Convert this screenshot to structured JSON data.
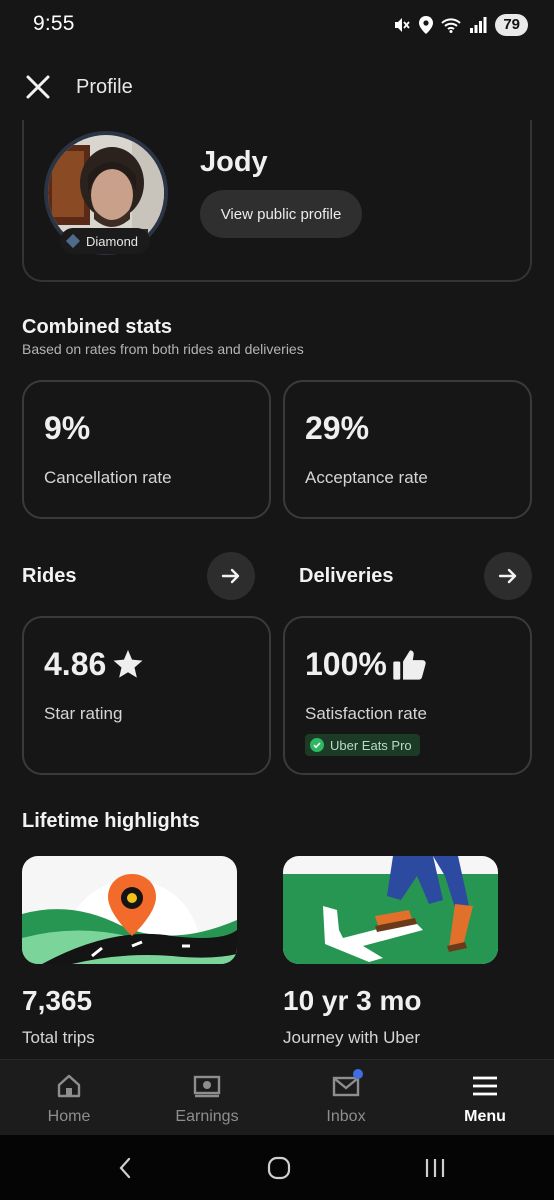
{
  "status_bar": {
    "time": "9:55",
    "battery": "79",
    "icons": [
      "mute-icon",
      "location-icon",
      "wifi-icon",
      "signal-icon"
    ]
  },
  "header": {
    "title": "Profile",
    "close_icon": "close-icon"
  },
  "profile": {
    "name": "Jody",
    "tier": "Diamond",
    "public_profile_label": "View public profile"
  },
  "combined_stats": {
    "title": "Combined stats",
    "subtitle": "Based on rates from both rides and deliveries",
    "cards": [
      {
        "value": "9%",
        "label": "Cancellation rate"
      },
      {
        "value": "29%",
        "label": "Acceptance rate"
      }
    ]
  },
  "rides": {
    "title": "Rides",
    "value": "4.86",
    "label": "Star rating",
    "icon": "star-icon"
  },
  "deliveries": {
    "title": "Deliveries",
    "value": "100%",
    "label": "Satisfaction rate",
    "icon": "thumbs-up-icon",
    "badge": "Uber Eats Pro"
  },
  "highlights": {
    "title": "Lifetime highlights",
    "items": [
      {
        "value": "7,365",
        "label": "Total trips"
      },
      {
        "value": "10 yr 3 mo",
        "label": "Journey with Uber"
      }
    ]
  },
  "bottom_nav": {
    "items": [
      {
        "label": "Home",
        "icon": "home-icon"
      },
      {
        "label": "Earnings",
        "icon": "earnings-icon"
      },
      {
        "label": "Inbox",
        "icon": "inbox-icon"
      },
      {
        "label": "Menu",
        "icon": "menu-icon"
      }
    ],
    "active": "Menu"
  },
  "colors": {
    "background": "#161616",
    "card_border": "#3a3a3a",
    "accent_green": "#2fb864",
    "notification_blue": "#3f6ee0"
  }
}
